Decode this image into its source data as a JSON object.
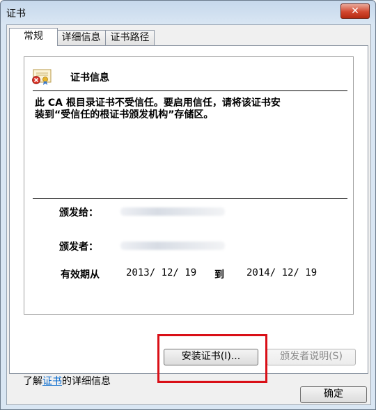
{
  "window": {
    "title": "证书",
    "close_label": "✕"
  },
  "tabs": [
    {
      "label": "常规",
      "active": true
    },
    {
      "label": "详细信息",
      "active": false
    },
    {
      "label": "证书路径",
      "active": false
    }
  ],
  "certificate": {
    "icon": "certificate-warning-icon",
    "heading": "证书信息",
    "warning_line1": "此 CA 根目录证书不受信任。要启用信任，请将该证书安",
    "warning_line2": "装到“受信任的根证书颁发机构”存储区。",
    "issued_to_label": "颁发给：",
    "issued_by_label": "颁发者：",
    "valid_from_label": "有效期从",
    "valid_from": "2013/ 12/ 19",
    "to_label": "到",
    "valid_to": "2014/ 12/ 19"
  },
  "buttons": {
    "install": "安装证书(I)...",
    "issuer_statement": "颁发者说明(S)",
    "ok": "确定"
  },
  "footer": {
    "prefix": "了解",
    "link": "证书",
    "suffix": "的详细信息"
  },
  "colors": {
    "highlight_border": "#d90f17",
    "link": "#0066cc"
  }
}
